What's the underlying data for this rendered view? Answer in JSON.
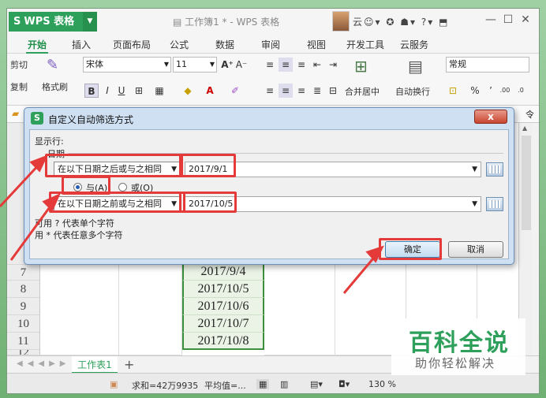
{
  "titlebar": {
    "app_name": "WPS 表格",
    "app_logo": "S",
    "doc_title": "工作簿1 * - WPS 表格",
    "user_label": "云",
    "icons": [
      "file-icon",
      "avatar",
      "cloud-sync-icon",
      "shirt-icon",
      "help-icon",
      "fullscreen-icon",
      "minimize-icon",
      "maximize-icon",
      "close-icon"
    ]
  },
  "menu": {
    "tabs": [
      "开始",
      "插入",
      "页面布局",
      "公式",
      "数据",
      "审阅",
      "视图",
      "开发工具",
      "云服务"
    ],
    "active": "开始"
  },
  "ribbon": {
    "cut": "剪切",
    "copy": "复制",
    "format_painter": "格式刷",
    "font_name": "宋体",
    "font_size": "11",
    "merge_center": "合并居中",
    "wrap_text": "自动换行",
    "number_format": "常规",
    "percent": "%",
    "comma": "’",
    "decimals_inc": ".00",
    "decimals_dec": ".0",
    "bold": "B",
    "italic": "I",
    "underline": "U",
    "font_grow": "A⁺",
    "font_shrink": "A⁻",
    "right_edge_text": "令"
  },
  "dialog": {
    "title": "自定义自动筛选方式",
    "close_label": "x",
    "show_rows_label": "显示行:",
    "field_label": "日期",
    "cond1": {
      "operator": "在以下日期之后或与之相同",
      "value": "2017/9/1"
    },
    "logic": {
      "and_label": "与(A)",
      "or_label": "或(O)",
      "selected": "and"
    },
    "cond2": {
      "operator": "在以下日期之前或与之相同",
      "value": "2017/10/5"
    },
    "hint1": "可用 ? 代表单个字符",
    "hint2": "用 * 代表任意多个字符",
    "ok_label": "确定",
    "cancel_label": "取消"
  },
  "grid": {
    "visible_rows": [
      {
        "row": "7",
        "date": "2017/9/4"
      },
      {
        "row": "8",
        "date": "2017/10/5"
      },
      {
        "row": "9",
        "date": "2017/10/6"
      },
      {
        "row": "10",
        "date": "2017/10/7"
      },
      {
        "row": "11",
        "date": "2017/10/8"
      },
      {
        "row": "12",
        "date": ""
      }
    ]
  },
  "sheets": {
    "active": "工作表1",
    "add_label": "+"
  },
  "status": {
    "sum": "求和=42万9935",
    "avg": "平均值=...",
    "zoom": "130 %"
  },
  "watermark": {
    "big": "百科全说",
    "small": "助你轻松解决"
  },
  "colors": {
    "accent": "#2ea05b",
    "highlight": "#e53a3a",
    "dialog_frame": "#cfe0f3"
  }
}
